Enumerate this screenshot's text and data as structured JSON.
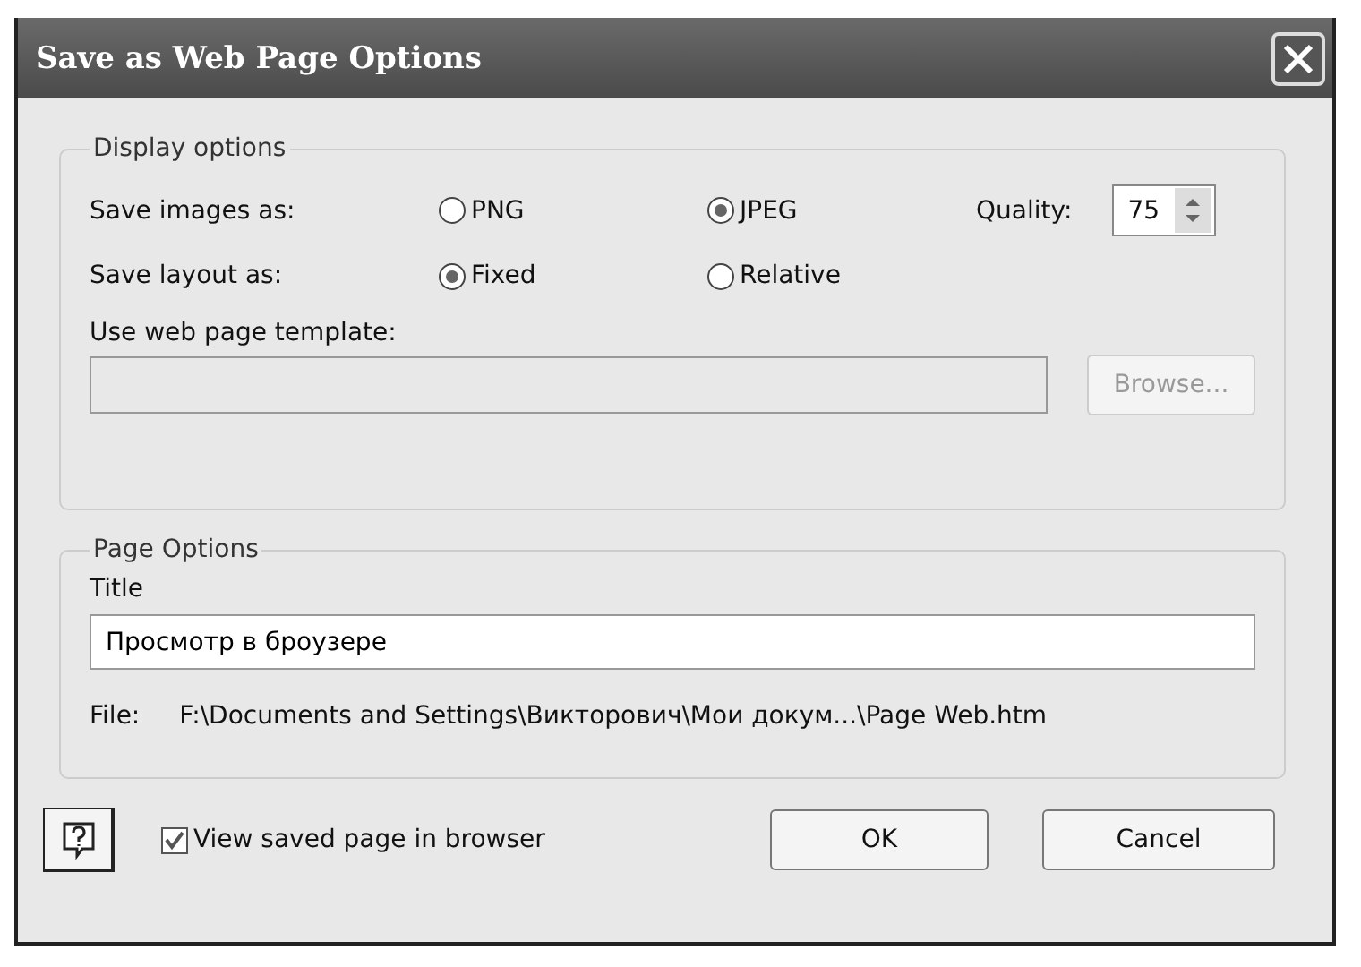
{
  "window": {
    "title": "Save as Web Page Options"
  },
  "display_options": {
    "legend": "Display options",
    "image_format": {
      "label": "Save images as:",
      "options": [
        {
          "label": "PNG",
          "selected": false
        },
        {
          "label": "JPEG",
          "selected": true
        }
      ]
    },
    "quality": {
      "label": "Quality:",
      "value": "75"
    },
    "layout": {
      "label": "Save layout as:",
      "options": [
        {
          "label": "Fixed",
          "selected": true
        },
        {
          "label": "Relative",
          "selected": false
        }
      ]
    },
    "template": {
      "label": "Use web page template:",
      "disabled": true
    },
    "browse_button": {
      "label": "Browse...",
      "disabled": true
    }
  },
  "page_options": {
    "legend": "Page Options",
    "title_label": "Title",
    "title_value": "Просмотр в броузере",
    "file_label": "File:",
    "file_path": "F:\\Documents and Settings\\Викторович\\Мои докум...\\Page Web.htm"
  },
  "view_in_browser": {
    "label": "View saved page in browser",
    "checked": true
  },
  "buttons": [
    {
      "label": "OK"
    },
    {
      "label": "Cancel"
    }
  ]
}
